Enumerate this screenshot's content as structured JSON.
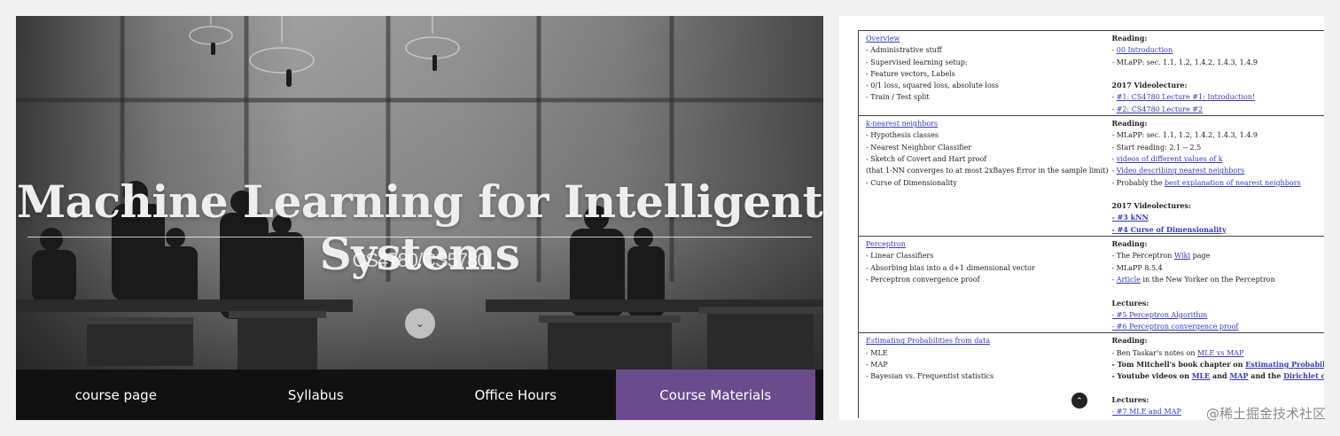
{
  "hero": {
    "title": "Machine Learning for Intelligent Systems",
    "subtitle": "CS4780/CS5780",
    "scroll_icon": "chevron-down-icon"
  },
  "nav": {
    "items": [
      {
        "label": "course page"
      },
      {
        "label": "Syllabus"
      },
      {
        "label": "Office Hours"
      },
      {
        "label": "Course Materials",
        "active": true
      }
    ],
    "active_color": "#6a4b8d"
  },
  "schedule": {
    "rows": [
      {
        "left": [
          {
            "text": "Overview",
            "link": true
          },
          {
            "text": "- Administrative stuff"
          },
          {
            "text": "- Supervised learning setup:"
          },
          {
            "text": "- Feature vectors, Labels"
          },
          {
            "text": "- 0/1 loss, squared loss, absolute loss"
          },
          {
            "text": "- Train / Test split"
          }
        ],
        "right": [
          {
            "text": "Reading:",
            "head": true
          },
          {
            "text": "- ",
            "link_text": "00 Introduction"
          },
          {
            "text": "- MLaPP: sec. 1.1, 1.2, 1.4.2, 1.4.3, 1.4.9"
          },
          {
            "text": ""
          },
          {
            "text": "2017 Videolecture:",
            "head": true
          },
          {
            "text": "- ",
            "link_text": "#1: CS4780 Lecture #1: Introduction!"
          },
          {
            "text": "- ",
            "link_text": "#2: CS4780 Lecture #2"
          }
        ]
      },
      {
        "left": [
          {
            "text": "k-nearest neighbors",
            "link": true
          },
          {
            "text": "- Hypothesis classes"
          },
          {
            "text": "- Nearest Neighbor Classifier"
          },
          {
            "text": "- Sketch of Covert and Hart proof"
          },
          {
            "text": "(that 1-NN converges to at most 2xBayes Error in the sample limit)"
          },
          {
            "text": "- Curse of Dimensionality"
          }
        ],
        "right": [
          {
            "text": "Reading:",
            "head": true
          },
          {
            "text": "- MLaPP: sec. 1.1, 1.2, 1.4.2, 1.4.3, 1.4.9"
          },
          {
            "text": "- Start reading: 2.1 -- 2.5"
          },
          {
            "text": "- ",
            "link_text": "videos of different values of k"
          },
          {
            "text": "- ",
            "link_text": "Video describing nearest neighbors"
          },
          {
            "text": "- Probably the ",
            "link_text": "best explanation of nearest neighbors"
          },
          {
            "text": ""
          },
          {
            "text": "2017 Videolectures:",
            "head": true
          },
          {
            "text": "",
            "link_text": "- #3 kNN",
            "bold": true
          },
          {
            "text": "",
            "link_text": "- #4 Curse of Dimensionality",
            "bold": true
          }
        ]
      },
      {
        "left": [
          {
            "text": "Perceptron",
            "link": true
          },
          {
            "text": "- Linear Classifiers"
          },
          {
            "text": "- Absorbing bias into a d+1 dimensional vector"
          },
          {
            "text": "- Perceptron convergence proof"
          }
        ],
        "right": [
          {
            "text": "Reading:",
            "head": true
          },
          {
            "text": "- The Perceptron ",
            "link_text": "Wiki",
            "after": " page"
          },
          {
            "text": "- MLaPP 8.5.4"
          },
          {
            "text": "- ",
            "link_text": "Article",
            "after": " in the New Yorker on the Perceptron"
          },
          {
            "text": ""
          },
          {
            "text": "Lectures:",
            "head": true
          },
          {
            "text": "",
            "link_text": "- #5 Perceptron Algorithm"
          },
          {
            "text": "",
            "link_text": "- #6 Perceptron convergence proof"
          }
        ]
      },
      {
        "left": [
          {
            "text": "Estimating Probabilities from data",
            "link": true
          },
          {
            "text": "- MLE"
          },
          {
            "text": "- MAP"
          },
          {
            "text": "- Bayesian vs. Frequentist statistics"
          }
        ],
        "right": [
          {
            "text": "Reading:",
            "head": true
          },
          {
            "text": "- Ben Taskar's notes on ",
            "link_text": "MLE vs MAP"
          },
          {
            "text": "- Tom Mitchell's book chapter on ",
            "link_text": "Estimating Probabilities",
            "bold": true
          },
          {
            "text": "- Youtube videos on ",
            "link_text": "MLE",
            "after": " and ",
            "link_text2": "MAP",
            "after2": " and the ",
            "link_text3": "Dirichlet distribution",
            "bold": true
          },
          {
            "text": ""
          },
          {
            "text": "Lectures:",
            "head": true
          },
          {
            "text": "",
            "link_text": "- #7 MLE and MAP"
          }
        ]
      }
    ],
    "scroll_top_icon": "chevron-up-icon"
  },
  "watermark": "@稀土掘金技术社区"
}
